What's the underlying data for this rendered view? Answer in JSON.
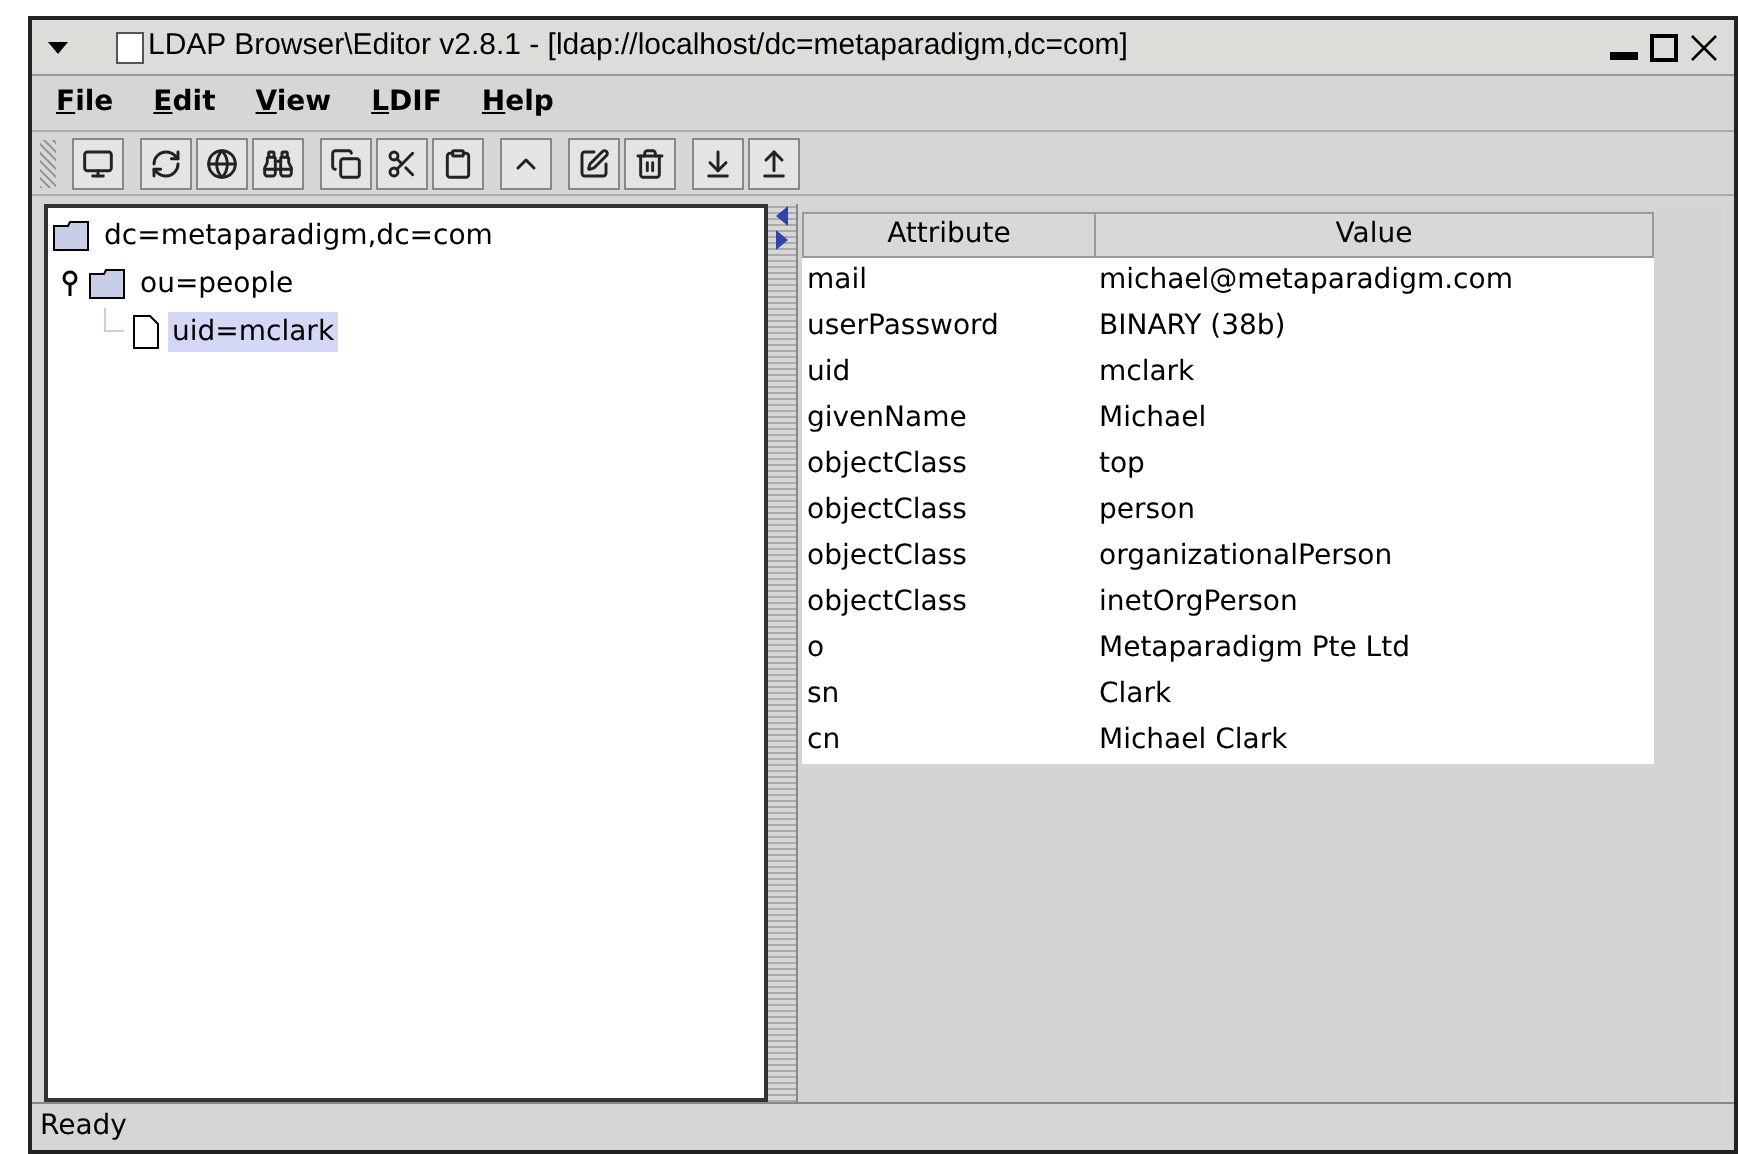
{
  "window": {
    "title": "LDAP Browser\\Editor v2.8.1 - [ldap://localhost/dc=metaparadigm,dc=com]"
  },
  "menu": [
    "File",
    "Edit",
    "View",
    "LDIF",
    "Help"
  ],
  "tree": [
    {
      "label": "dc=metaparadigm,dc=com",
      "kind": "folder",
      "selected": false,
      "children": [
        {
          "label": "ou=people",
          "kind": "folder",
          "selected": false,
          "children": [
            {
              "label": "uid=mclark",
              "kind": "entry",
              "selected": true
            }
          ]
        }
      ]
    }
  ],
  "table": {
    "columns": [
      "Attribute",
      "Value"
    ],
    "rows": [
      [
        "mail",
        "michael@metaparadigm.com"
      ],
      [
        "userPassword",
        "BINARY (38b)"
      ],
      [
        "uid",
        "mclark"
      ],
      [
        "givenName",
        "Michael"
      ],
      [
        "objectClass",
        "top"
      ],
      [
        "objectClass",
        "person"
      ],
      [
        "objectClass",
        "organizationalPerson"
      ],
      [
        "objectClass",
        "inetOrgPerson"
      ],
      [
        "o",
        "Metaparadigm Pte Ltd"
      ],
      [
        "sn",
        "Clark"
      ],
      [
        "cn",
        "Michael Clark"
      ]
    ]
  },
  "status_bar": "Ready"
}
